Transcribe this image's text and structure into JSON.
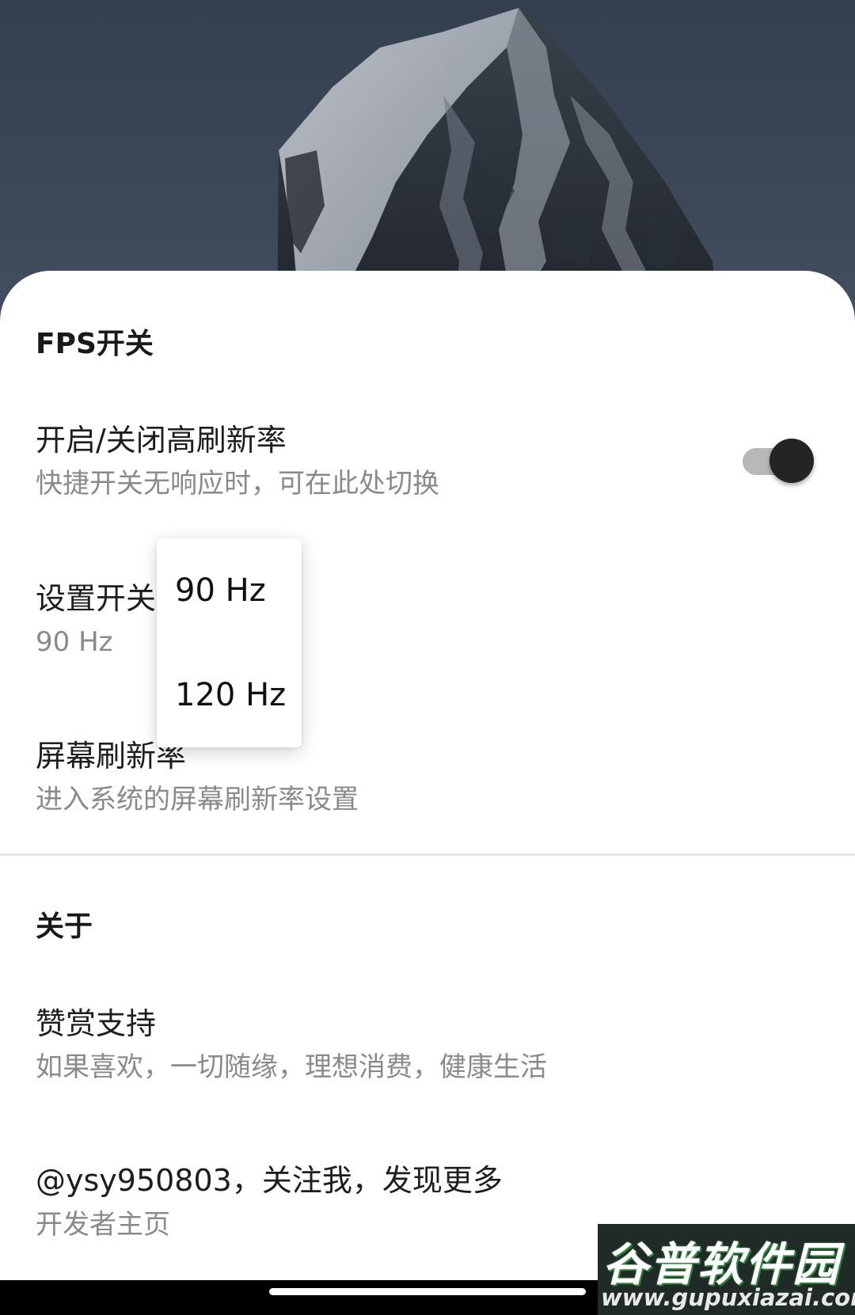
{
  "fps_section": {
    "title": "FPS开关",
    "toggle_item": {
      "title": "开启/关闭高刷新率",
      "subtitle": "快捷开关无响应时，可在此处切换",
      "enabled": true
    },
    "rate_item": {
      "title": "设置开关刷新率",
      "subtitle": "90 Hz"
    },
    "screen_item": {
      "title": "屏幕刷新率",
      "subtitle": "进入系统的屏幕刷新率设置"
    }
  },
  "popup_menu": {
    "options": [
      "90 Hz",
      "120 Hz"
    ]
  },
  "about_section": {
    "title": "关于",
    "donate_item": {
      "title": "赞赏支持",
      "subtitle": "如果喜欢，一切随缘，理想消费，健康生活"
    },
    "developer_item": {
      "title": "@ysy950803，关注我，发现更多",
      "subtitle": "开发者主页"
    }
  },
  "watermark": {
    "brand": "谷普软件园",
    "url": "www.gupuxiazai.com"
  },
  "colors": {
    "wallpaper_sky": "#3c4857",
    "toggle_thumb": "#242424",
    "toggle_track": "#b8b8b8",
    "subtitle_text": "#8a8a8a"
  }
}
